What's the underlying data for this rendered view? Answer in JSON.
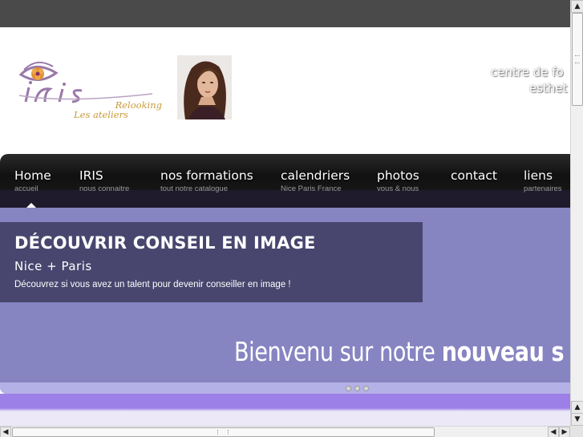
{
  "header": {
    "logo": {
      "brand": "IRIS",
      "line1": "Relooking",
      "line2": "Les ateliers"
    },
    "tagline": {
      "line1": "centre de fo",
      "line2": "esthet"
    }
  },
  "nav": {
    "items": [
      {
        "label": "Home",
        "sub": "accueil"
      },
      {
        "label": "IRIS",
        "sub": "nous connaitre"
      },
      {
        "label": "nos formations",
        "sub": "tout notre catalogue"
      },
      {
        "label": "calendriers",
        "sub": "Nice Paris France"
      },
      {
        "label": "photos",
        "sub": "vous & nous"
      },
      {
        "label": "contact",
        "sub": ""
      },
      {
        "label": "liens",
        "sub": "partenaires"
      }
    ],
    "active_index": 0
  },
  "slider": {
    "caption": {
      "title": "DÉCOUVRIR CONSEIL EN IMAGE",
      "subtitle": "Nice + Paris",
      "text": "Découvrez si vous avez un talent pour devenir conseiller en image !"
    },
    "welcome_prefix": "Bienvenu sur notre ",
    "welcome_bold": "nouveau s",
    "slide_count": 3
  },
  "colors": {
    "topbar": "#4a4a4a",
    "navbar": "#141414",
    "slider_bg": "#8784c2",
    "caption_bg": "#48466e",
    "logo_gold": "#c89a3a",
    "logo_purple": "#9a78a8"
  },
  "icons": {
    "scroll_up": "▲",
    "scroll_down": "▼",
    "scroll_left": "◀",
    "scroll_right": "▶"
  }
}
